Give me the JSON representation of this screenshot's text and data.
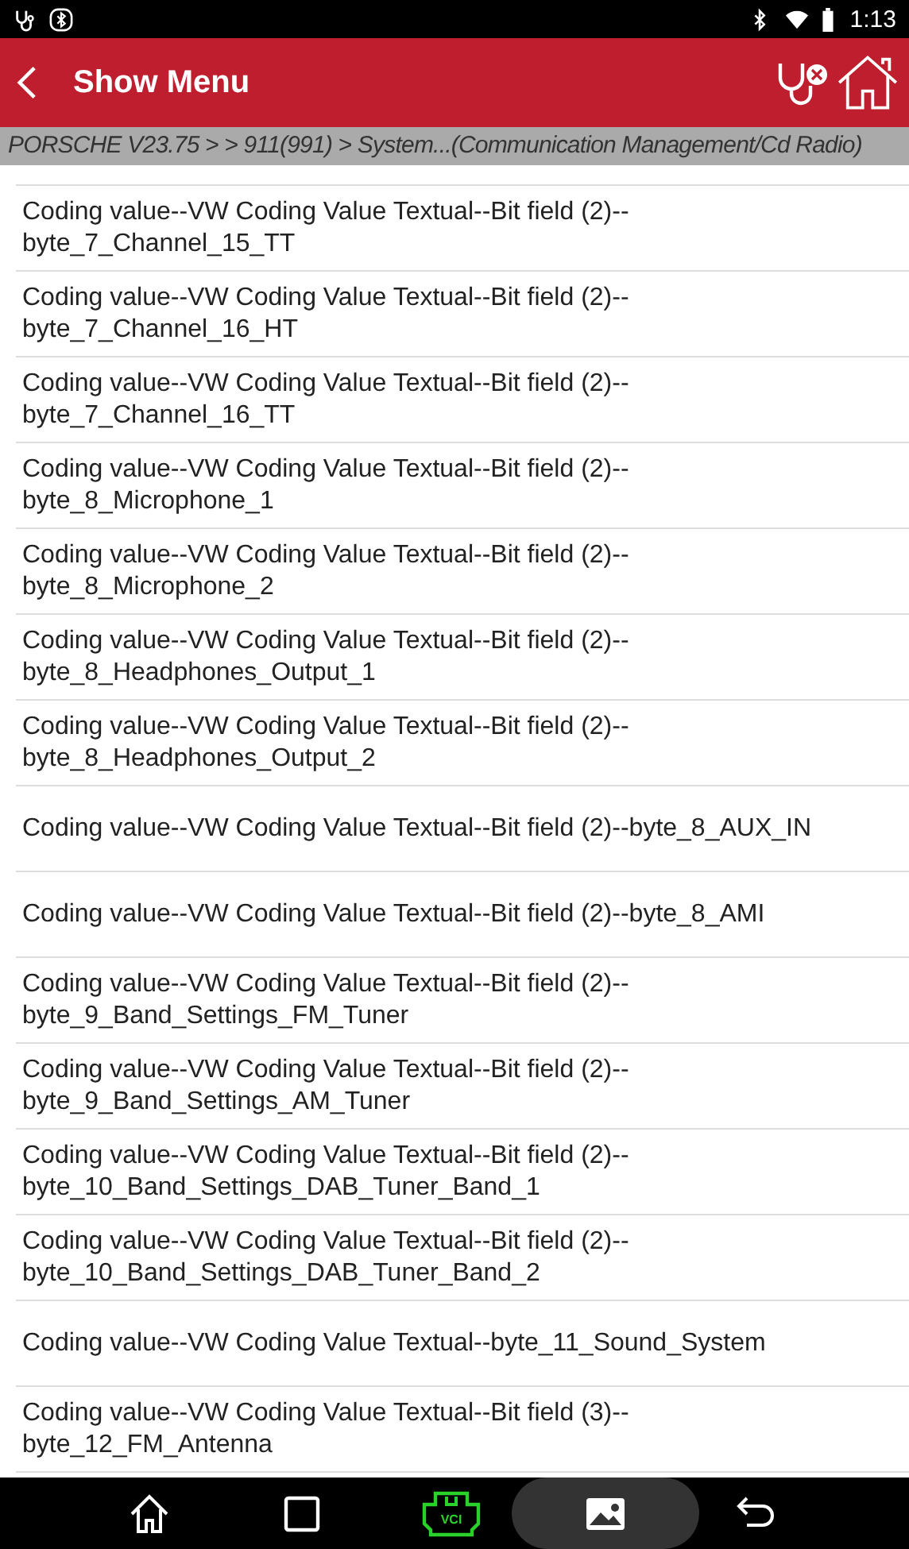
{
  "status_bar": {
    "time": "1:13"
  },
  "header": {
    "title": "Show Menu"
  },
  "breadcrumb": "PORSCHE V23.75 >  > 911(991) > System...(Communication Management/Cd Radio)",
  "menu_items": [
    {
      "lines": [
        "Coding value--VW Coding Value Textual--Bit field (2)--",
        "byte_7_Channel_15_TT"
      ]
    },
    {
      "lines": [
        "Coding value--VW Coding Value Textual--Bit field (2)--",
        "byte_7_Channel_16_HT"
      ]
    },
    {
      "lines": [
        "Coding value--VW Coding Value Textual--Bit field (2)--",
        "byte_7_Channel_16_TT"
      ]
    },
    {
      "lines": [
        "Coding value--VW Coding Value Textual--Bit field (2)--",
        "byte_8_Microphone_1"
      ]
    },
    {
      "lines": [
        "Coding value--VW Coding Value Textual--Bit field (2)--",
        "byte_8_Microphone_2"
      ]
    },
    {
      "lines": [
        "Coding value--VW Coding Value Textual--Bit field (2)--",
        "byte_8_Headphones_Output_1"
      ]
    },
    {
      "lines": [
        "Coding value--VW Coding Value Textual--Bit field (2)--",
        "byte_8_Headphones_Output_2"
      ]
    },
    {
      "lines": [
        "Coding value--VW Coding Value Textual--Bit field (2)--byte_8_AUX_IN"
      ]
    },
    {
      "lines": [
        "Coding value--VW Coding Value Textual--Bit field (2)--byte_8_AMI"
      ]
    },
    {
      "lines": [
        "Coding value--VW Coding Value Textual--Bit field (2)--",
        "byte_9_Band_Settings_FM_Tuner"
      ]
    },
    {
      "lines": [
        "Coding value--VW Coding Value Textual--Bit field (2)--",
        "byte_9_Band_Settings_AM_Tuner"
      ]
    },
    {
      "lines": [
        "Coding value--VW Coding Value Textual--Bit field (2)--",
        "byte_10_Band_Settings_DAB_Tuner_Band_1"
      ]
    },
    {
      "lines": [
        "Coding value--VW Coding Value Textual--Bit field (2)--",
        "byte_10_Band_Settings_DAB_Tuner_Band_2"
      ]
    },
    {
      "lines": [
        "Coding value--VW Coding Value Textual--byte_11_Sound_System"
      ]
    },
    {
      "lines": [
        "Coding value--VW Coding Value Textual--Bit field (3)--",
        "byte_12_FM_Antenna"
      ]
    }
  ],
  "nav_bar": {
    "vci_label": "VCI"
  }
}
